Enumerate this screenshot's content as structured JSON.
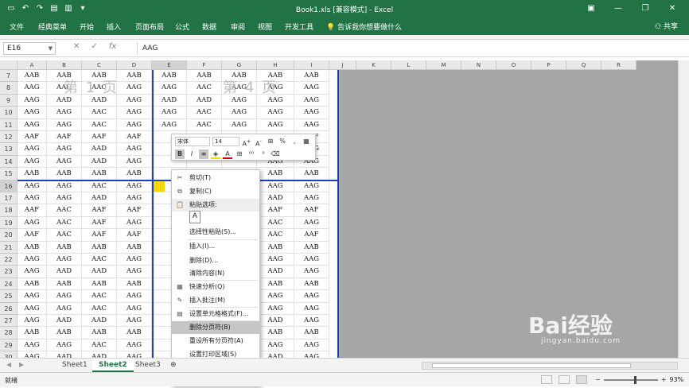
{
  "app": {
    "title": "Book1.xls  [兼容模式]  -  Excel",
    "qat": [
      "save-icon",
      "undo-icon",
      "redo-icon",
      "open-icon",
      "print-icon",
      "customize-icon"
    ]
  },
  "ribbon": {
    "tabs": [
      "文件",
      "经典菜单",
      "开始",
      "插入",
      "页面布局",
      "公式",
      "数据",
      "审阅",
      "视图",
      "开发工具"
    ],
    "tell_me": "告诉我你想要做什么",
    "share": "共享"
  },
  "formula_bar": {
    "name_box": "E16",
    "value": "AAG"
  },
  "columns": [
    "A",
    "B",
    "C",
    "D",
    "E",
    "F",
    "G",
    "H",
    "I",
    "J",
    "K",
    "L",
    "M",
    "N",
    "O",
    "P",
    "Q",
    "R"
  ],
  "rows": [
    {
      "n": "7",
      "cells": [
        "AAB",
        "AAB",
        "AAB",
        "AAB",
        "AAB",
        "AAB",
        "AAB",
        "AAB",
        "AAB"
      ]
    },
    {
      "n": "8",
      "cells": [
        "AAG",
        "AAG",
        "AAC",
        "AAG",
        "AAG",
        "AAC",
        "AAG",
        "AAG",
        "AAG"
      ]
    },
    {
      "n": "9",
      "cells": [
        "AAG",
        "AAD",
        "AAD",
        "AAG",
        "AAD",
        "AAD",
        "AAG",
        "AAG",
        "AAG"
      ]
    },
    {
      "n": "10",
      "cells": [
        "AAG",
        "AAG",
        "AAC",
        "AAG",
        "AAG",
        "AAC",
        "AAG",
        "AAG",
        "AAG"
      ]
    },
    {
      "n": "11",
      "cells": [
        "AAG",
        "AAG",
        "AAC",
        "AAG",
        "AAG",
        "AAC",
        "AAG",
        "AAG",
        "AAG"
      ]
    },
    {
      "n": "12",
      "cells": [
        "AAF",
        "AAF",
        "AAF",
        "AAF",
        "",
        "",
        "",
        "AAF",
        "AAF"
      ]
    },
    {
      "n": "13",
      "cells": [
        "AAG",
        "AAG",
        "AAD",
        "AAG",
        "",
        "",
        "",
        "AAG",
        "AAG"
      ]
    },
    {
      "n": "14",
      "cells": [
        "AAG",
        "AAG",
        "AAD",
        "AAG",
        "",
        "",
        "",
        "AAG",
        "AAG"
      ]
    },
    {
      "n": "15",
      "cells": [
        "AAB",
        "AAB",
        "AAB",
        "AAB",
        "",
        "",
        "",
        "AAB",
        "AAB"
      ]
    },
    {
      "n": "16",
      "cells": [
        "AAG",
        "AAG",
        "AAC",
        "AAG",
        "",
        "",
        "",
        "AAG",
        "AAG"
      ]
    },
    {
      "n": "17",
      "cells": [
        "AAG",
        "AAG",
        "AAD",
        "AAG",
        "",
        "",
        "",
        "AAD",
        "AAG"
      ]
    },
    {
      "n": "18",
      "cells": [
        "AAF",
        "AAC",
        "AAF",
        "AAF",
        "",
        "",
        "",
        "AAF",
        "AAF"
      ]
    },
    {
      "n": "19",
      "cells": [
        "AAG",
        "AAC",
        "AAF",
        "AAG",
        "",
        "",
        "",
        "AAC",
        "AAG"
      ]
    },
    {
      "n": "20",
      "cells": [
        "AAF",
        "AAC",
        "AAF",
        "AAF",
        "",
        "",
        "",
        "AAC",
        "AAF"
      ]
    },
    {
      "n": "21",
      "cells": [
        "AAB",
        "AAB",
        "AAB",
        "AAB",
        "",
        "",
        "",
        "AAB",
        "AAB"
      ]
    },
    {
      "n": "22",
      "cells": [
        "AAG",
        "AAG",
        "AAC",
        "AAG",
        "",
        "",
        "",
        "AAG",
        "AAG"
      ]
    },
    {
      "n": "23",
      "cells": [
        "AAG",
        "AAD",
        "AAD",
        "AAG",
        "",
        "",
        "",
        "AAD",
        "AAG"
      ]
    },
    {
      "n": "24",
      "cells": [
        "AAB",
        "AAB",
        "AAB",
        "AAB",
        "",
        "",
        "",
        "AAB",
        "AAB"
      ]
    },
    {
      "n": "25",
      "cells": [
        "AAG",
        "AAG",
        "AAC",
        "AAG",
        "",
        "",
        "",
        "AAG",
        "AAG"
      ]
    },
    {
      "n": "26",
      "cells": [
        "AAG",
        "AAG",
        "AAC",
        "AAG",
        "",
        "",
        "",
        "AAG",
        "AAG"
      ]
    },
    {
      "n": "27",
      "cells": [
        "AAG",
        "AAD",
        "AAD",
        "AAG",
        "",
        "",
        "",
        "AAD",
        "AAG"
      ]
    },
    {
      "n": "28",
      "cells": [
        "AAB",
        "AAB",
        "AAB",
        "AAB",
        "",
        "",
        "",
        "AAB",
        "AAB"
      ]
    },
    {
      "n": "29",
      "cells": [
        "AAG",
        "AAG",
        "AAC",
        "AAG",
        "",
        "",
        "",
        "AAG",
        "AAG"
      ]
    },
    {
      "n": "30",
      "cells": [
        "AAG",
        "AAD",
        "AAD",
        "AAG",
        "",
        "",
        "",
        "AAD",
        "AAG"
      ]
    }
  ],
  "page_watermarks": [
    "第 1 页",
    "第 4 页"
  ],
  "mini_toolbar": {
    "font": "宋体",
    "size": "14",
    "bold": "B",
    "italic": "I",
    "percent": "%",
    "comma": ","
  },
  "context_menu": [
    {
      "label": "剪切(T)",
      "icon": "scissors-icon"
    },
    {
      "label": "复制(C)",
      "icon": "copy-icon"
    },
    {
      "label": "粘贴选项:",
      "icon": "paste-icon",
      "header": true
    },
    {
      "label": "",
      "icon": "paste-a-icon",
      "paste_box": true
    },
    {
      "label": "选择性粘贴(S)...",
      "icon": ""
    },
    {
      "label": "插入(I)...",
      "icon": ""
    },
    {
      "label": "删除(D)...",
      "icon": ""
    },
    {
      "label": "清除内容(N)",
      "icon": ""
    },
    {
      "label": "快速分析(Q)",
      "icon": "quick-analysis-icon"
    },
    {
      "label": "插入批注(M)",
      "icon": "comment-icon"
    },
    {
      "label": "设置单元格格式(F)...",
      "icon": "format-cells-icon"
    },
    {
      "label": "删除分页符(B)",
      "icon": "",
      "highlight": true
    },
    {
      "label": "重设所有分页符(A)",
      "icon": ""
    },
    {
      "label": "设置打印区域(S)",
      "icon": ""
    },
    {
      "label": "重设打印区域(R)",
      "icon": ""
    },
    {
      "label": "页面设置(U)...",
      "icon": ""
    }
  ],
  "sheets": [
    "Sheet1",
    "Sheet2",
    "Sheet3"
  ],
  "active_sheet": "Sheet2",
  "status": {
    "ready": "就绪",
    "zoom": "93%"
  },
  "colors": {
    "excel_green": "#217346",
    "page_break": "#1f3fbd",
    "selected_cell": "#f5d80a",
    "menu_highlight": "#c6c6c6"
  },
  "watermark": {
    "logo": "Bai经验",
    "url": "jingyan.baidu.com"
  }
}
